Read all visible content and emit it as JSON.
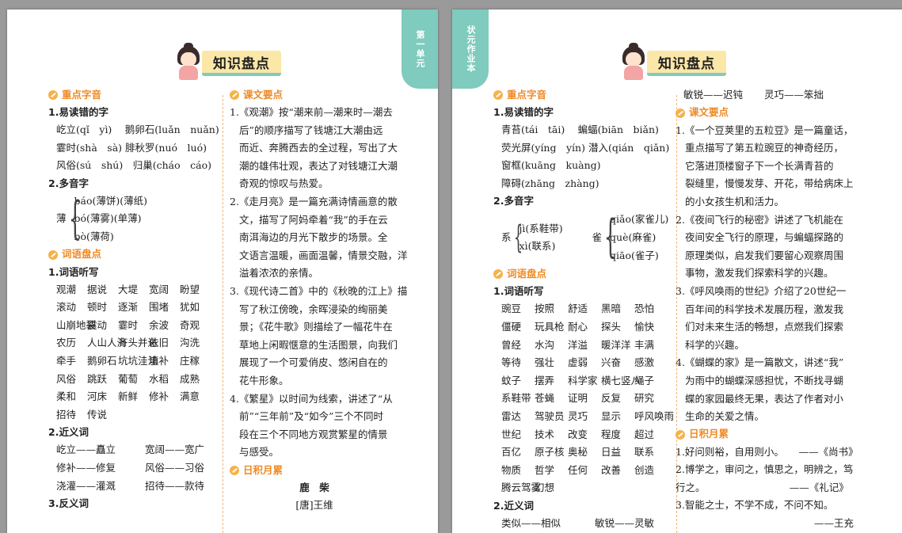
{
  "left": {
    "tab": "第一单元",
    "title": "知识盘点",
    "c1": {
      "sec1": "重点字音",
      "sub1": "1.易读错的字",
      "pron": [
        "屹立(qǐ　yì)　 鹅卵石(luǎn　nuǎn)",
        "霎时(shà　sà) 腓秋罗(nuó　luó)",
        "风俗(sú　shú)　归巢(cháo　cáo)"
      ],
      "sub2": "2.多音字",
      "poly_char": "薄",
      "poly": [
        "báo(薄饼)(薄纸)",
        "bó(薄雾)(单薄)",
        "bò(薄荷)"
      ],
      "sec2": "词语盘点",
      "sub3": "1.词语听写",
      "words": [
        "观潮",
        "据说",
        "大堤",
        "宽阔",
        "盼望",
        "滚动",
        "顿时",
        "逐渐",
        "围堵",
        "犹如",
        "山崩地裂",
        "震动",
        "霎时",
        "余波",
        "奇观",
        "农历",
        "人山人海",
        "齐头并进",
        "依旧",
        "沟洗",
        "牵手",
        "鹅卵石",
        "坑坑洼洼",
        "填补",
        "庄稼",
        "风俗",
        "跳跃",
        "葡萄",
        "水稻",
        "成熟",
        "柔和",
        "河床",
        "新鲜",
        "修补",
        "满意",
        "招待",
        "传说"
      ],
      "sub4": "2.近义词",
      "syn": [
        "屹立——矗立",
        "宽阔——宽广",
        "修补——修复",
        "风俗——习俗",
        "浇灌——灌溉",
        "招待——款待"
      ],
      "sub5": "3.反义词"
    },
    "c2": {
      "sec1": "课文要点",
      "items": [
        [
          "1.《观潮》按“潮来前—潮来时—潮去",
          "后”的顺序描写了钱塘江大潮由远",
          "而近、奔腾西去的全过程，写出了大",
          "潮的雄伟壮观，表达了对钱塘江大潮",
          "奇观的惊叹与热爱。"
        ],
        [
          "2.《走月亮》是一篇充满诗情画意的散",
          "文，描写了阿妈牵着“我”的手在云",
          "南洱海边的月光下散步的场景。全",
          "文语言温暖，画面温馨，情景交融，洋",
          "溢着浓浓的亲情。"
        ],
        [
          "3.《现代诗二首》中的《秋晚的江上》描",
          "写了秋江傍晚，余晖浸染的绚丽美",
          "景；《花牛歌》则描绘了一幅花牛在",
          "草地上闲暇惬意的生活图景，向我们",
          "展现了一个可爱俏皮、悠闲自在的",
          "花牛形象。"
        ],
        [
          "4.《繁星》以时间为线索，讲述了“从",
          "前”“三年前”及“如今”三个不同时",
          "段在三个不同地方观赏繁星的情景",
          "与感受。"
        ]
      ],
      "sec2": "日积月累",
      "poem_title": "鹿　柴",
      "poem_author": "[唐]王维"
    }
  },
  "right": {
    "tab": "状元作业本",
    "title": "知识盘点",
    "c1": {
      "sec1": "重点字音",
      "sub1": "1.易读错的字",
      "pron": [
        "青苔(tái　tāi)　 蝙蝠(biān　biǎn)",
        "荧光屏(yíng　yín) 潜入(qián　qiǎn)",
        "窗框(kuāng　kuàng)",
        "障碍(zhāng　zhàng)"
      ],
      "sub2": "2.多音字",
      "poly1_char": "系",
      "poly1": [
        "jì(系鞋带)",
        "xì(联系)"
      ],
      "poly2_char": "雀",
      "poly2": [
        "qiǎo(家雀儿)",
        "què(麻雀)",
        "qiāo(雀子)"
      ],
      "sec2": "词语盘点",
      "sub3": "1.词语听写",
      "words": [
        "豌豆",
        "按照",
        "舒适",
        "黑暗",
        "恐怕",
        "僵硬",
        "玩具枪",
        "耐心",
        "探头",
        "愉快",
        "曾经",
        "水沟",
        "洋溢",
        "暖洋洋",
        "丰满",
        "等待",
        "强壮",
        "虚弱",
        "兴奋",
        "感激",
        "蚊子",
        "摆弄",
        "科学家",
        "横七竖八",
        "绳子",
        "系鞋带",
        "苍蝇",
        "证明",
        "反复",
        "研究",
        "雷达",
        "驾驶员",
        "灵巧",
        "显示",
        "呼风唤雨",
        "世纪",
        "技术",
        "改变",
        "程度",
        "超过",
        "百亿",
        "原子核",
        "奥秘",
        "日益",
        "联系",
        "物质",
        "哲学",
        "任何",
        "改善",
        "创造",
        "腾云驾雾",
        "幻想"
      ],
      "sub4": "2.近义词",
      "syn": [
        "类似——相似",
        "敏锐——灵敏"
      ]
    },
    "c2": {
      "top": [
        "敏锐——迟钝",
        "灵巧——笨拙"
      ],
      "sec1": "课文要点",
      "items": [
        [
          "1.《一个豆荚里的五粒豆》是一篇童话，",
          "重点描写了第五粒豌豆的神奇经历，",
          "它落进顶楼窗子下一个长满青苔的",
          "裂缝里，慢慢发芽、开花，带给病床上",
          "的小女孩生机和活力。"
        ],
        [
          "2.《夜间飞行的秘密》讲述了飞机能在",
          "夜间安全飞行的原理，与蝙蝠探路的",
          "原理类似，启发我们要留心观察周围",
          "事物，激发我们探索科学的兴趣。"
        ],
        [
          "3.《呼风唤雨的世纪》介绍了20世纪一",
          "百年间的科学技术发展历程，激发我",
          "们对未来生活的畅想，点燃我们探索",
          "科学的兴趣。"
        ],
        [
          "4.《蝴蝶的家》是一篇散文，讲述“我”",
          "为雨中的蝴蝶深感担忧，不断找寻蝴",
          "蝶的家园最终无果，表达了作者对小",
          "生命的关爱之情。"
        ]
      ],
      "sec2": "日积月累",
      "quotes": [
        "1.好问则裕，自用则小。　　——《尚书》",
        "2.博学之，审问之，慎思之，明辨之，笃",
        "行之。　　　　　　　　　——《礼记》",
        "3.智能之士，不学不成，不问不知。",
        "　　　　　　　　　　　　　　——王充"
      ]
    }
  },
  "colors": {
    "accent": "#7fcbbe",
    "section": "#f08a24",
    "underline": "#e0343c",
    "banner": "#fbe7a8"
  }
}
